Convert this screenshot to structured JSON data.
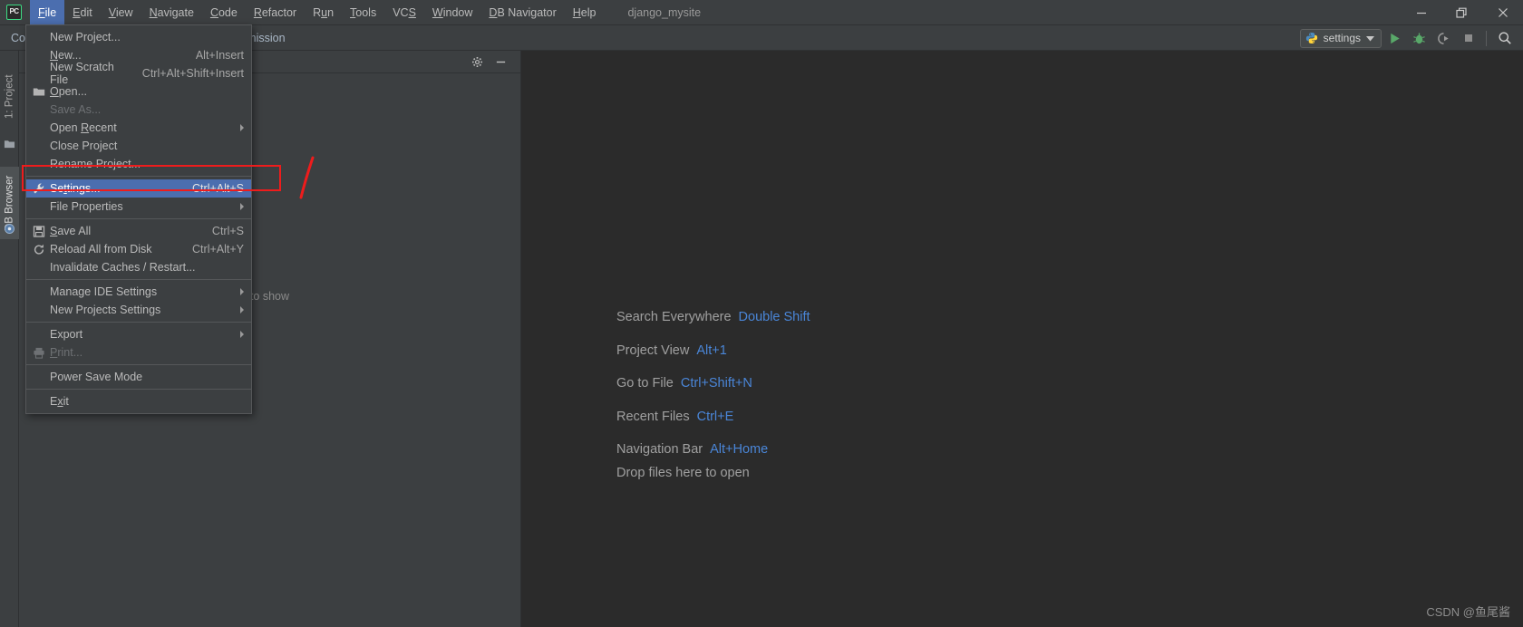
{
  "app": {
    "logo_text": "PC",
    "project_name": "django_mysite"
  },
  "menubar": {
    "items": [
      {
        "label": "File",
        "mnemonic": "F",
        "active": true
      },
      {
        "label": "Edit",
        "mnemonic": "E",
        "active": false
      },
      {
        "label": "View",
        "mnemonic": "V",
        "active": false
      },
      {
        "label": "Navigate",
        "mnemonic": "N",
        "active": false
      },
      {
        "label": "Code",
        "mnemonic": "C",
        "active": false
      },
      {
        "label": "Refactor",
        "mnemonic": "R",
        "active": false
      },
      {
        "label": "Run",
        "mnemonic": "u",
        "active": false
      },
      {
        "label": "Tools",
        "mnemonic": "T",
        "active": false
      },
      {
        "label": "VCS",
        "mnemonic": "S",
        "active": false
      },
      {
        "label": "Window",
        "mnemonic": "W",
        "active": false
      },
      {
        "label": "DB Navigator",
        "mnemonic": "D",
        "active": false
      },
      {
        "label": "Help",
        "mnemonic": "H",
        "active": false
      }
    ]
  },
  "window_controls": {
    "minimize": "minimize-icon",
    "restore": "restore-icon",
    "close": "close-icon"
  },
  "toolbar": {
    "breadcrumb_head": "Con",
    "breadcrumb_tail": "rmission",
    "run_config": {
      "name": "settings",
      "icon": "python-icon",
      "chevron": "chevron-down-icon"
    },
    "buttons": [
      {
        "name": "run-button",
        "icon": "run-triangle-icon"
      },
      {
        "name": "debug-button",
        "icon": "bug-icon"
      },
      {
        "name": "run-coverage-button",
        "icon": "coverage-icon"
      },
      {
        "name": "stop-button",
        "icon": "stop-square-icon"
      },
      {
        "name": "search-button",
        "icon": "search-icon"
      }
    ]
  },
  "file_menu": {
    "items": [
      {
        "label": "New Project...",
        "mnemonic": "",
        "shortcut": "",
        "icon": "",
        "type": "item",
        "disabled": false,
        "selected": false,
        "submenu": false
      },
      {
        "label": "New...",
        "mnemonic": "N",
        "shortcut": "Alt+Insert",
        "icon": "",
        "type": "item",
        "disabled": false,
        "selected": false,
        "submenu": false
      },
      {
        "label": "New Scratch File",
        "mnemonic": "",
        "shortcut": "Ctrl+Alt+Shift+Insert",
        "icon": "",
        "type": "item",
        "disabled": false,
        "selected": false,
        "submenu": false
      },
      {
        "label": "Open...",
        "mnemonic": "O",
        "shortcut": "",
        "icon": "folder-icon",
        "type": "item",
        "disabled": false,
        "selected": false,
        "submenu": false
      },
      {
        "label": "Save As...",
        "mnemonic": "",
        "shortcut": "",
        "icon": "",
        "type": "item",
        "disabled": true,
        "selected": false,
        "submenu": false
      },
      {
        "label": "Open Recent",
        "mnemonic": "R",
        "shortcut": "",
        "icon": "",
        "type": "item",
        "disabled": false,
        "selected": false,
        "submenu": true
      },
      {
        "label": "Close Project",
        "mnemonic": "",
        "shortcut": "",
        "icon": "",
        "type": "item",
        "disabled": false,
        "selected": false,
        "submenu": false
      },
      {
        "label": "Rename Project...",
        "mnemonic": "",
        "shortcut": "",
        "icon": "",
        "type": "item",
        "disabled": false,
        "selected": false,
        "submenu": false
      },
      {
        "type": "separator"
      },
      {
        "label": "Settings...",
        "mnemonic": "t",
        "shortcut": "Ctrl+Alt+S",
        "icon": "wrench-icon",
        "type": "item",
        "disabled": false,
        "selected": true,
        "submenu": false
      },
      {
        "label": "File Properties",
        "mnemonic": "",
        "shortcut": "",
        "icon": "",
        "type": "item",
        "disabled": false,
        "selected": false,
        "submenu": true
      },
      {
        "type": "separator"
      },
      {
        "label": "Save All",
        "mnemonic": "S",
        "shortcut": "Ctrl+S",
        "icon": "save-icon",
        "type": "item",
        "disabled": false,
        "selected": false,
        "submenu": false
      },
      {
        "label": "Reload All from Disk",
        "mnemonic": "",
        "shortcut": "Ctrl+Alt+Y",
        "icon": "reload-icon",
        "type": "item",
        "disabled": false,
        "selected": false,
        "submenu": false
      },
      {
        "label": "Invalidate Caches / Restart...",
        "mnemonic": "",
        "shortcut": "",
        "icon": "",
        "type": "item",
        "disabled": false,
        "selected": false,
        "submenu": false
      },
      {
        "type": "separator"
      },
      {
        "label": "Manage IDE Settings",
        "mnemonic": "",
        "shortcut": "",
        "icon": "",
        "type": "item",
        "disabled": false,
        "selected": false,
        "submenu": true
      },
      {
        "label": "New Projects Settings",
        "mnemonic": "",
        "shortcut": "",
        "icon": "",
        "type": "item",
        "disabled": false,
        "selected": false,
        "submenu": true
      },
      {
        "type": "separator"
      },
      {
        "label": "Export",
        "mnemonic": "",
        "shortcut": "",
        "icon": "",
        "type": "item",
        "disabled": false,
        "selected": false,
        "submenu": true
      },
      {
        "label": "Print...",
        "mnemonic": "P",
        "shortcut": "",
        "icon": "print-icon",
        "type": "item",
        "disabled": true,
        "selected": false,
        "submenu": false
      },
      {
        "type": "separator"
      },
      {
        "label": "Power Save Mode",
        "mnemonic": "",
        "shortcut": "",
        "icon": "",
        "type": "item",
        "disabled": false,
        "selected": false,
        "submenu": false
      },
      {
        "type": "separator"
      },
      {
        "label": "Exit",
        "mnemonic": "x",
        "shortcut": "",
        "icon": "",
        "type": "item",
        "disabled": false,
        "selected": false,
        "submenu": false
      }
    ]
  },
  "left_strip": {
    "tabs": [
      {
        "label": "1: Project",
        "mnemonic": "1",
        "selected": false,
        "icon": "folder-icon"
      },
      {
        "label": "DB Browser",
        "mnemonic": "",
        "selected": true,
        "icon": "db-browser-icon"
      }
    ]
  },
  "left_panel": {
    "settings_icon": "gear-icon",
    "hide_icon": "minimize-icon",
    "empty_text": "to show"
  },
  "welcome": {
    "tips": [
      {
        "label": "Search Everywhere",
        "key": "Double Shift"
      },
      {
        "label": "Project View",
        "key": "Alt+1"
      },
      {
        "label": "Go to File",
        "key": "Ctrl+Shift+N"
      },
      {
        "label": "Recent Files",
        "key": "Ctrl+E"
      },
      {
        "label": "Navigation Bar",
        "key": "Alt+Home"
      }
    ],
    "drop_text": "Drop files here to open"
  },
  "watermark": "CSDN @鱼尾酱",
  "colors": {
    "accent_blue": "#4b6eaf",
    "link_blue": "#4a86d8",
    "annotation_red": "#ee1c1c",
    "panel_bg": "#3c3f41",
    "editor_bg": "#2b2b2b"
  }
}
